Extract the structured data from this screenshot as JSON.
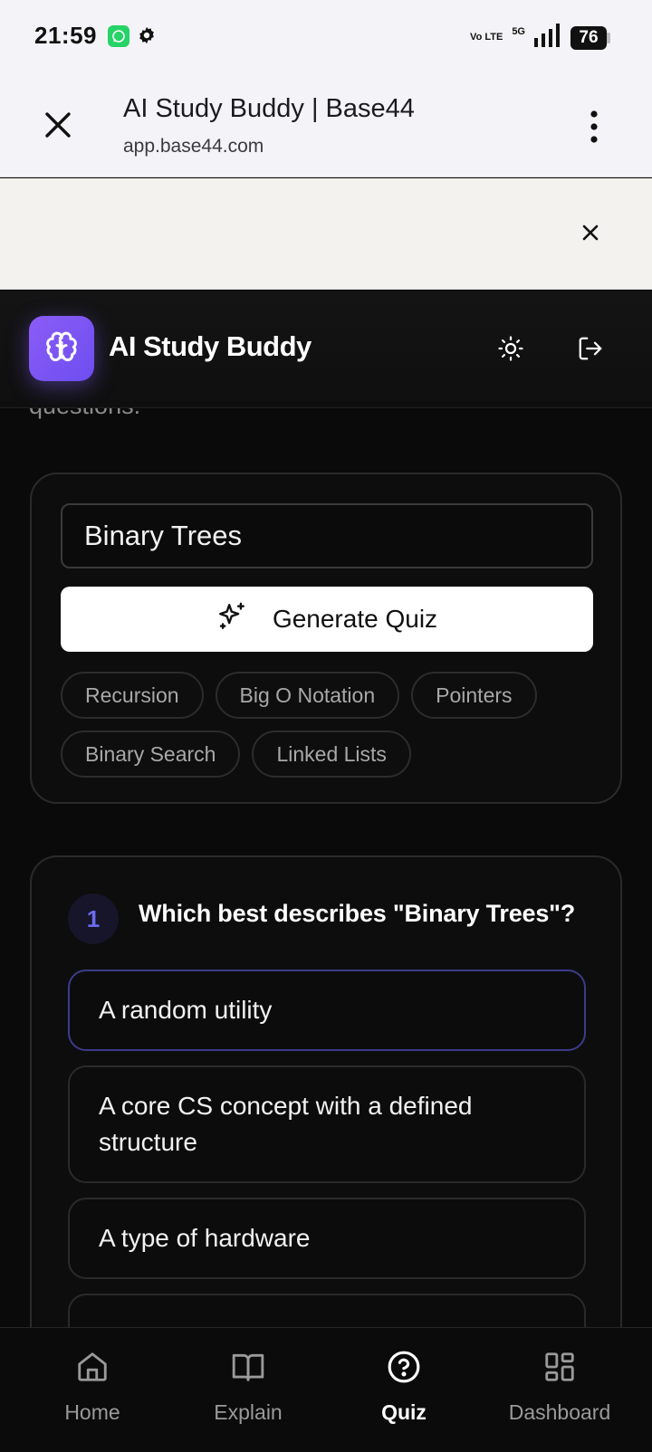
{
  "status_bar": {
    "time": "21:59",
    "volte": "Vo LTE",
    "network": "5G",
    "battery": "76",
    "icons": [
      "whatsapp-icon",
      "settings-gear-icon",
      "signal-icon",
      "battery-icon"
    ]
  },
  "browser": {
    "title": "AI Study Buddy | Base44",
    "url": "app.base44.com"
  },
  "app": {
    "name": "AI Study Buddy",
    "accent": "#7c5cf6"
  },
  "content": {
    "cutoff_text": "questions."
  },
  "generator": {
    "topic_value": "Binary Trees",
    "generate_label": "Generate Quiz",
    "chips": [
      "Recursion",
      "Big O Notation",
      "Pointers",
      "Binary Search",
      "Linked Lists"
    ]
  },
  "quiz": {
    "number": "1",
    "question": "Which best describes \"Binary Trees\"?",
    "options": [
      "A random utility",
      "A core CS concept with a defined structure",
      "A type of hardware"
    ]
  },
  "nav": {
    "items": [
      {
        "label": "Home",
        "icon": "home-icon"
      },
      {
        "label": "Explain",
        "icon": "book-icon"
      },
      {
        "label": "Quiz",
        "icon": "question-circle-icon"
      },
      {
        "label": "Dashboard",
        "icon": "grid-icon"
      }
    ],
    "active": "Quiz"
  }
}
